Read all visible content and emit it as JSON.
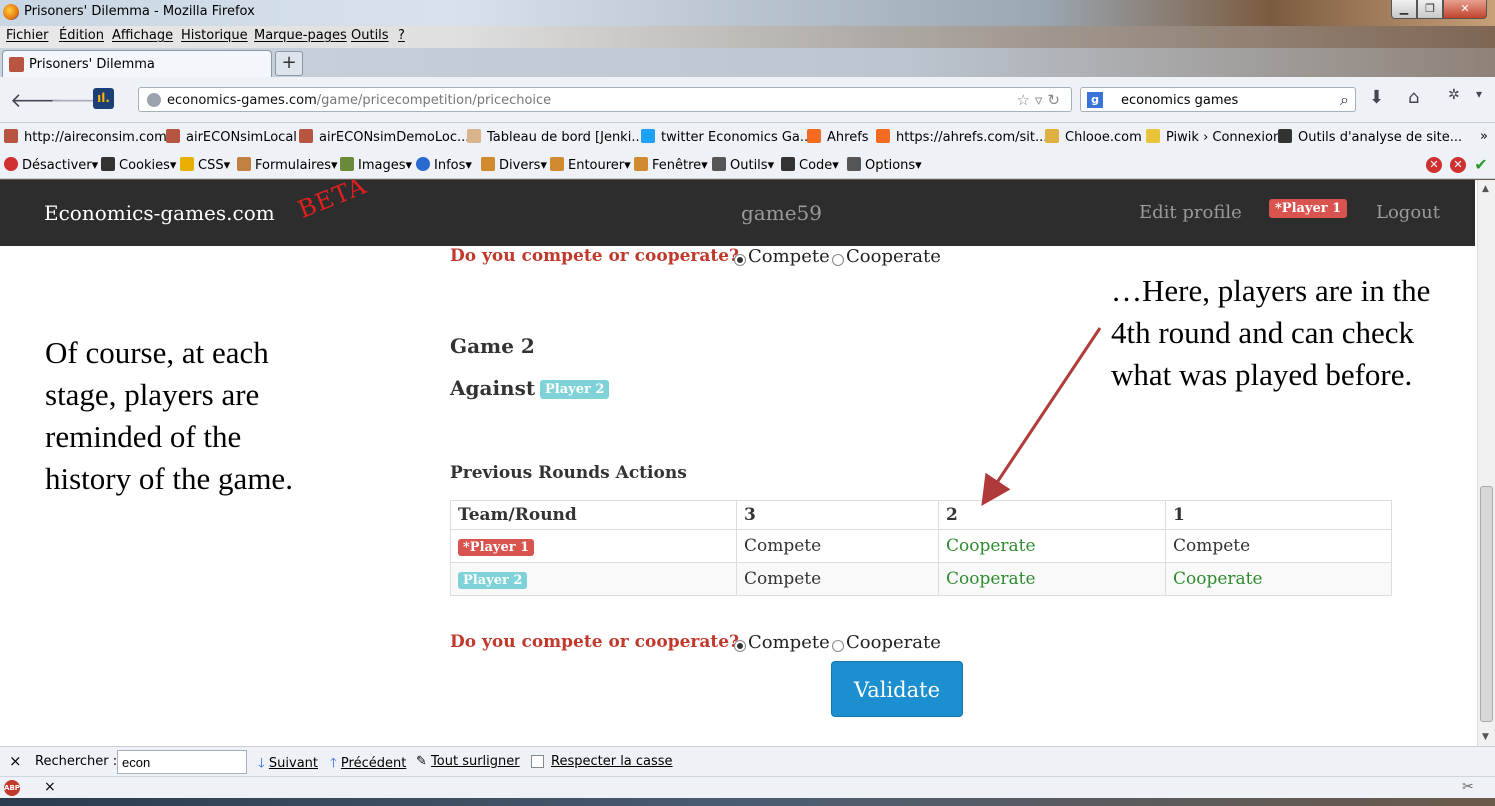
{
  "window": {
    "title": "Prisoners' Dilemma - Mozilla Firefox",
    "buttons": [
      "▁",
      "❐",
      "✕"
    ]
  },
  "menu": [
    "Fichier",
    "Édition",
    "Affichage",
    "Historique",
    "Marque-pages",
    "Outils",
    "?"
  ],
  "tab": {
    "title": "Prisoners' Dilemma",
    "new_tab": "+"
  },
  "address": {
    "host": "economics-games.com",
    "path": "/game/pricecompetition/pricechoice",
    "search_engine": "g",
    "search_text": "economics games"
  },
  "bookmarks": [
    {
      "label": "http://aireconsim.com",
      "color": "#b85540"
    },
    {
      "label": "airECONsimLocal",
      "color": "#b85540"
    },
    {
      "label": "airECONsimDemoLoc...",
      "color": "#b85540"
    },
    {
      "label": "Tableau de bord [Jenki...",
      "color": "#d9b38c"
    },
    {
      "label": "twitter Economics Ga...",
      "color": "#1da1f2"
    },
    {
      "label": "Ahrefs",
      "color": "#f26b21"
    },
    {
      "label": "https://ahrefs.com/sit...",
      "color": "#f26b21"
    },
    {
      "label": "Chlooe.com",
      "color": "#e0b040"
    },
    {
      "label": "Piwik › Connexion",
      "color": "#e8c43a"
    },
    {
      "label": "Outils d'analyse de site...",
      "color": "#333333"
    }
  ],
  "bookmarks_more": "»",
  "devtools": [
    {
      "label": "Désactiver",
      "color": "#d03030"
    },
    {
      "label": "Cookies",
      "color": "#333333"
    },
    {
      "label": "CSS",
      "color": "#e8b000"
    },
    {
      "label": "Formulaires",
      "color": "#c08040"
    },
    {
      "label": "Images",
      "color": "#6a8a3a"
    },
    {
      "label": "Infos",
      "color": "#2a6ad0"
    },
    {
      "label": "Divers",
      "color": "#d08a30"
    },
    {
      "label": "Entourer",
      "color": "#d08a30"
    },
    {
      "label": "Fenêtre",
      "color": "#d08a30"
    },
    {
      "label": "Outils",
      "color": "#555555"
    },
    {
      "label": "Code",
      "color": "#333333"
    },
    {
      "label": "Options",
      "color": "#555555"
    }
  ],
  "site": {
    "brand": "Economics-games.com",
    "beta": "BETA",
    "game_name": "game59",
    "edit_profile": "Edit profile",
    "current_player": "*Player 1",
    "logout": "Logout"
  },
  "top_question": {
    "prompt": "Do you compete or cooperate?",
    "options": [
      "Compete",
      "Cooperate"
    ],
    "selected": "Compete"
  },
  "game": {
    "heading": "Game 2",
    "against_label": "Against",
    "opponent": "Player 2"
  },
  "previous_rounds": {
    "title": "Previous Rounds Actions",
    "columns": [
      "Team/Round",
      "3",
      "2",
      "1"
    ],
    "rows": [
      {
        "team": "*Player 1",
        "actions": [
          "Compete",
          "Cooperate",
          "Compete"
        ]
      },
      {
        "team": "Player 2",
        "actions": [
          "Compete",
          "Cooperate",
          "Cooperate"
        ]
      }
    ]
  },
  "bottom_question": {
    "prompt": "Do you compete or cooperate?",
    "options": [
      "Compete",
      "Cooperate"
    ],
    "selected": "Compete"
  },
  "validate_label": "Validate",
  "annotations": {
    "left": "Of course, at each stage, players are reminded of the history of the game.",
    "right": "…Here, players are in the 4th round and can check what was played before."
  },
  "findbar": {
    "close": "×",
    "label": "Rechercher :",
    "value": "econ",
    "next": "Suivant",
    "prev": "Précédent",
    "highlight": "Tout surligner",
    "match_case": "Respecter la casse"
  },
  "addonbar": {
    "abp": "ABP",
    "close": "×"
  }
}
